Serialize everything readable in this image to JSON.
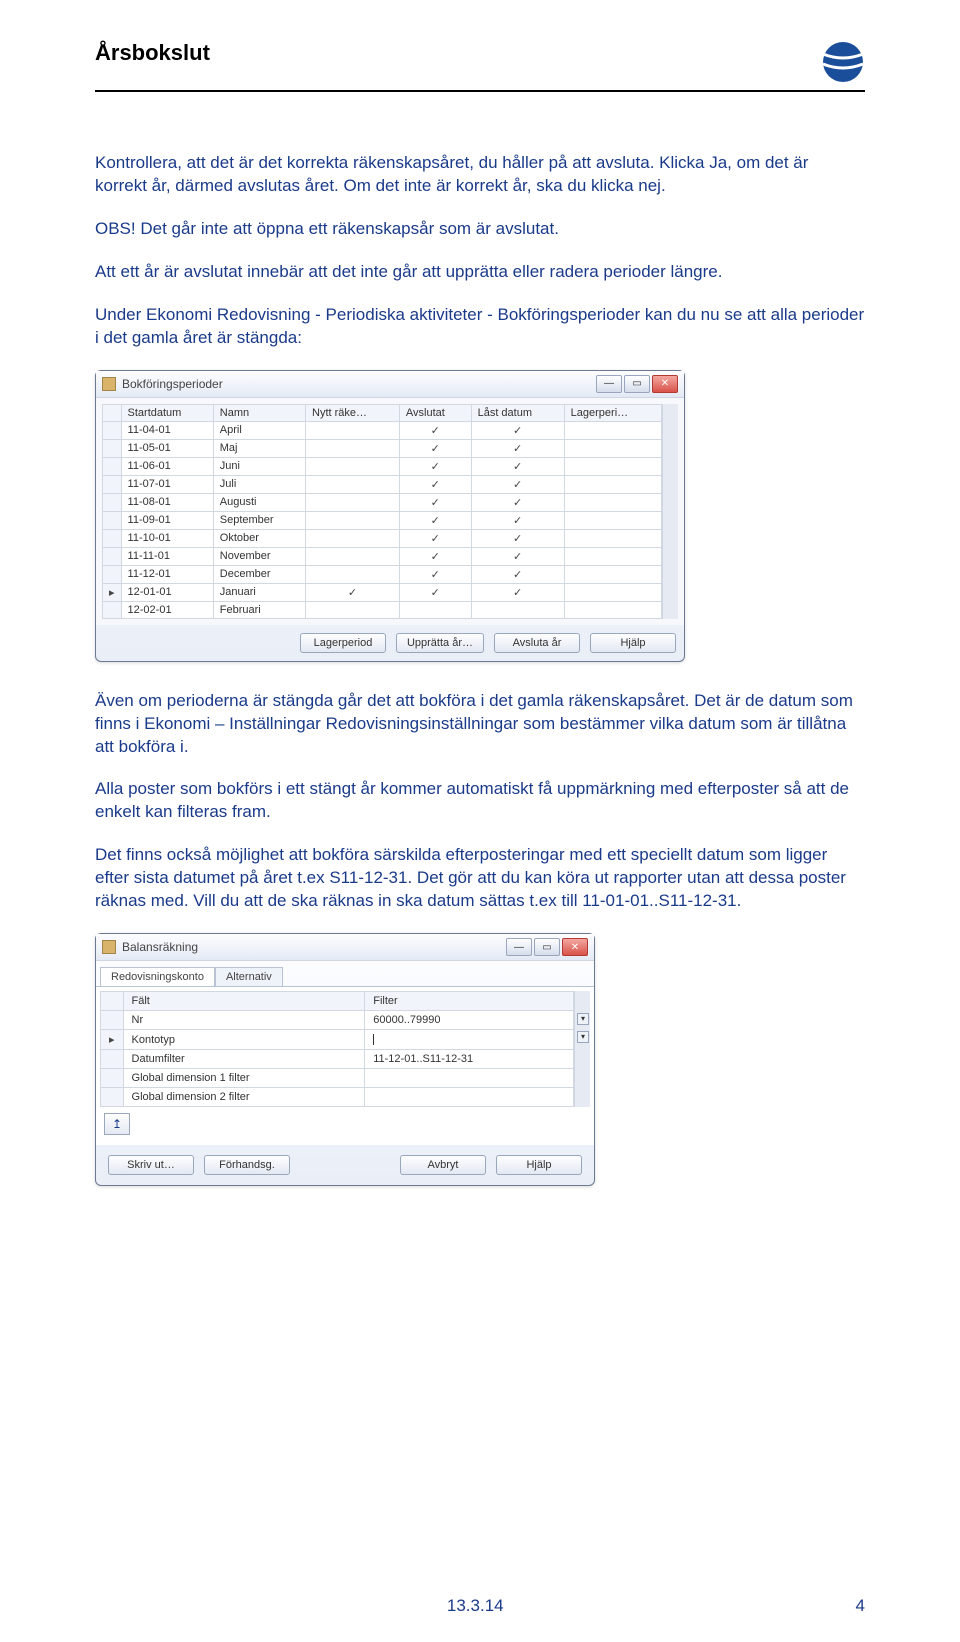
{
  "header": {
    "title": "Årsbokslut"
  },
  "paragraphs": {
    "p1": "Kontrollera, att det är det korrekta räkenskapsåret, du håller på att avsluta. Klicka Ja, om det är korrekt år, därmed avslutas året. Om det inte är korrekt år, ska du klicka nej.",
    "p2": "OBS! Det går inte att öppna ett räkenskapsår som är avslutat.",
    "p3": "Att ett år är avslutat innebär att det inte går att upprätta eller radera perioder längre.",
    "p4": "Under Ekonomi Redovisning - Periodiska aktiviteter - Bokföringsperioder kan du nu se att alla perioder i det gamla året är stängda:",
    "p5": "Även om perioderna är stängda går det att bokföra i det gamla räkenskapsåret. Det är de datum som finns i Ekonomi – Inställningar Redovisningsinställningar som bestämmer vilka datum som är tillåtna att bokföra i.",
    "p6": "Alla poster som bokförs i ett stängt år kommer automatiskt få uppmärkning med efterposter så att de enkelt kan filteras fram.",
    "p7": "Det finns också möjlighet att bokföra särskilda efterposteringar med ett speciellt datum som ligger efter sista datumet på året t.ex S11-12-31. Det gör att du kan köra ut rapporter utan att dessa poster räknas med. Vill du att de ska räknas in ska datum sättas t.ex till 11-01-01..S11-12-31."
  },
  "window1": {
    "title": "Bokföringsperioder",
    "columns": [
      "Startdatum",
      "Namn",
      "Nytt räke…",
      "Avslutat",
      "Låst datum",
      "Lagerperi…"
    ],
    "rows": [
      {
        "date": "11-04-01",
        "name": "April",
        "ny": false,
        "av": true,
        "ld": true,
        "lp": ""
      },
      {
        "date": "11-05-01",
        "name": "Maj",
        "ny": false,
        "av": true,
        "ld": true,
        "lp": ""
      },
      {
        "date": "11-06-01",
        "name": "Juni",
        "ny": false,
        "av": true,
        "ld": true,
        "lp": ""
      },
      {
        "date": "11-07-01",
        "name": "Juli",
        "ny": false,
        "av": true,
        "ld": true,
        "lp": ""
      },
      {
        "date": "11-08-01",
        "name": "Augusti",
        "ny": false,
        "av": true,
        "ld": true,
        "lp": ""
      },
      {
        "date": "11-09-01",
        "name": "September",
        "ny": false,
        "av": true,
        "ld": true,
        "lp": ""
      },
      {
        "date": "11-10-01",
        "name": "Oktober",
        "ny": false,
        "av": true,
        "ld": true,
        "lp": ""
      },
      {
        "date": "11-11-01",
        "name": "November",
        "ny": false,
        "av": true,
        "ld": true,
        "lp": ""
      },
      {
        "date": "11-12-01",
        "name": "December",
        "ny": false,
        "av": true,
        "ld": true,
        "lp": ""
      },
      {
        "date": "12-01-01",
        "name": "Januari",
        "ny": true,
        "av": true,
        "ld": true,
        "lp": ""
      },
      {
        "date": "12-02-01",
        "name": "Februari",
        "ny": false,
        "av": false,
        "ld": false,
        "lp": ""
      }
    ],
    "buttons": {
      "lager": "Lagerperiod",
      "uppratta": "Upprätta år…",
      "avsluta": "Avsluta år",
      "hjalp": "Hjälp"
    }
  },
  "window2": {
    "title": "Balansräkning",
    "tabs": {
      "active": "Redovisningskonto",
      "other": "Alternativ"
    },
    "headers": {
      "falt": "Fält",
      "filter": "Filter"
    },
    "rows": [
      {
        "falt": "Nr",
        "filter": "60000..79990"
      },
      {
        "falt": "Kontotyp",
        "filter": ""
      },
      {
        "falt": "Datumfilter",
        "filter": "11-12-01..S11-12-31"
      },
      {
        "falt": "Global dimension 1 filter",
        "filter": ""
      },
      {
        "falt": "Global dimension 2 filter",
        "filter": ""
      }
    ],
    "buttons": {
      "skriv": "Skriv ut…",
      "forh": "Förhandsg.",
      "avbryt": "Avbryt",
      "hjalp": "Hjälp"
    }
  },
  "footer": {
    "date": "13.3.14",
    "page": "4"
  }
}
